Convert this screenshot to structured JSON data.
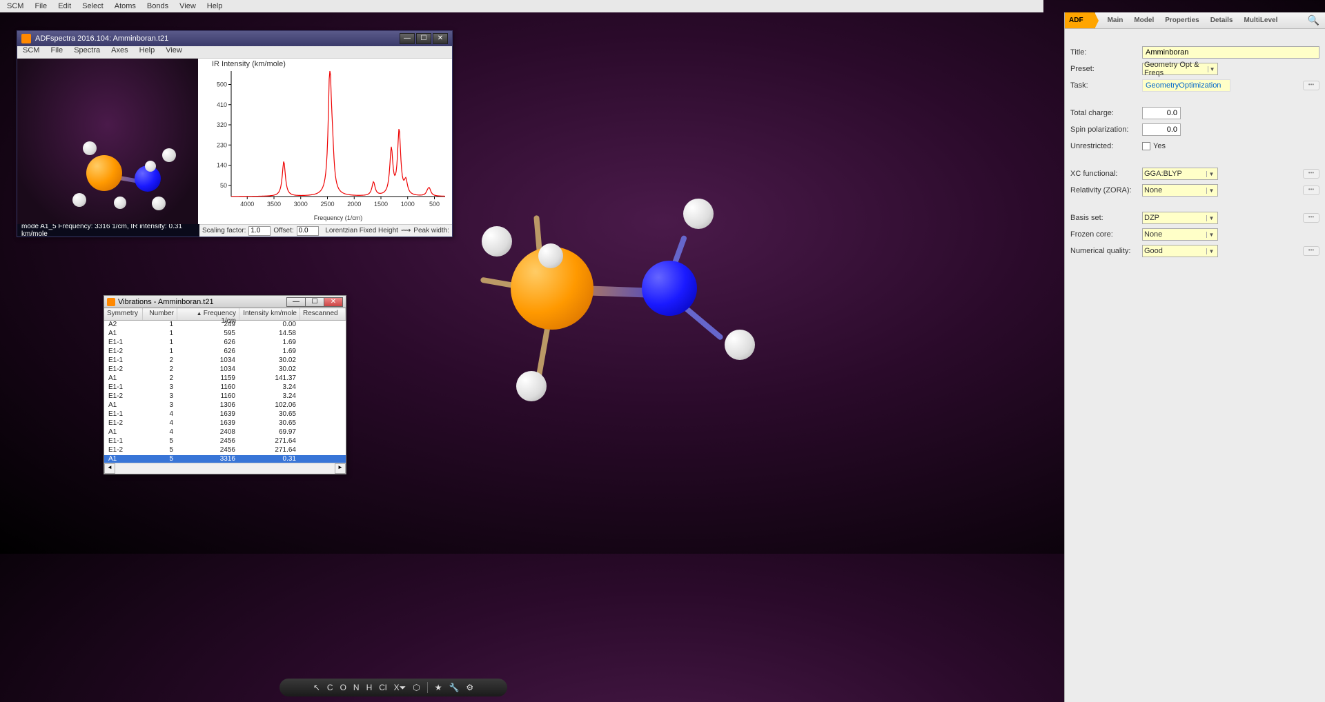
{
  "top_menu": [
    "SCM",
    "File",
    "Edit",
    "Select",
    "Atoms",
    "Bonds",
    "View",
    "Help"
  ],
  "right_panel": {
    "tabs": [
      "ADF",
      "Main",
      "Model",
      "Properties",
      "Details",
      "MultiLevel"
    ],
    "title_label": "Title:",
    "title_value": "Amminboran",
    "preset_label": "Preset:",
    "preset_value": "Geometry Opt & Freqs",
    "task_label": "Task:",
    "task_value": "GeometryOptimization",
    "charge_label": "Total charge:",
    "charge_value": "0.0",
    "spin_label": "Spin polarization:",
    "spin_value": "0.0",
    "unrestricted_label": "Unrestricted:",
    "unrestricted_yes": "Yes",
    "xc_label": "XC functional:",
    "xc_value": "GGA:BLYP",
    "rel_label": "Relativity (ZORA):",
    "rel_value": "None",
    "basis_label": "Basis set:",
    "basis_value": "DZP",
    "frozen_label": "Frozen core:",
    "frozen_value": "None",
    "numq_label": "Numerical quality:",
    "numq_value": "Good"
  },
  "spectra": {
    "title": "ADFspectra 2016.104: Amminboran.t21",
    "menu": [
      "SCM",
      "File",
      "Spectra",
      "Axes",
      "Help",
      "View"
    ],
    "status": "mode A1_5 Frequency: 3316 1/cm, IR intensity:   0.31 km/mole",
    "footer": {
      "scaling_label": "Scaling factor:",
      "scaling_value": "1.0",
      "offset_label": "Offset:",
      "offset_value": "0.0",
      "shape": "Lorentzian Fixed Height",
      "peak_label": "Peak width:"
    }
  },
  "vibrations": {
    "title": "Vibrations - Amminboran.t21",
    "headers": [
      "Symmetry",
      "Number",
      "Frequency 1/cm",
      "Intensity km/mole",
      "Rescanned"
    ],
    "rows": [
      {
        "sym": "A2",
        "num": "1",
        "freq": "249",
        "int": "0.00"
      },
      {
        "sym": "A1",
        "num": "1",
        "freq": "595",
        "int": "14.58"
      },
      {
        "sym": "E1-1",
        "num": "1",
        "freq": "626",
        "int": "1.69"
      },
      {
        "sym": "E1-2",
        "num": "1",
        "freq": "626",
        "int": "1.69"
      },
      {
        "sym": "E1-1",
        "num": "2",
        "freq": "1034",
        "int": "30.02"
      },
      {
        "sym": "E1-2",
        "num": "2",
        "freq": "1034",
        "int": "30.02"
      },
      {
        "sym": "A1",
        "num": "2",
        "freq": "1159",
        "int": "141.37"
      },
      {
        "sym": "E1-1",
        "num": "3",
        "freq": "1160",
        "int": "3.24"
      },
      {
        "sym": "E1-2",
        "num": "3",
        "freq": "1160",
        "int": "3.24"
      },
      {
        "sym": "A1",
        "num": "3",
        "freq": "1306",
        "int": "102.06"
      },
      {
        "sym": "E1-1",
        "num": "4",
        "freq": "1639",
        "int": "30.65"
      },
      {
        "sym": "E1-2",
        "num": "4",
        "freq": "1639",
        "int": "30.65"
      },
      {
        "sym": "A1",
        "num": "4",
        "freq": "2408",
        "int": "69.97"
      },
      {
        "sym": "E1-1",
        "num": "5",
        "freq": "2456",
        "int": "271.64"
      },
      {
        "sym": "E1-2",
        "num": "5",
        "freq": "2456",
        "int": "271.64"
      },
      {
        "sym": "A1",
        "num": "5",
        "freq": "3316",
        "int": "0.31",
        "sel": true
      }
    ]
  },
  "bottom_tools": [
    "↖",
    "C",
    "O",
    "N",
    "H",
    "Cl",
    "X⏷",
    "⬡",
    "",
    "★",
    "🔧",
    "⚙"
  ],
  "chart_data": {
    "type": "line",
    "title": "IR Intensity (km/mole)",
    "xlabel": "Frequency (1/cm)",
    "ylabel": "",
    "xlim": [
      4300,
      300
    ],
    "ylim": [
      0,
      560
    ],
    "xticks": [
      4000,
      3500,
      3000,
      2500,
      2000,
      1500,
      1000,
      500
    ],
    "yticks": [
      50,
      140,
      230,
      320,
      410,
      500
    ],
    "peaks": [
      {
        "x": 3316,
        "y": 156
      },
      {
        "x": 2456,
        "y": 543
      },
      {
        "x": 2408,
        "y": 140
      },
      {
        "x": 1639,
        "y": 61
      },
      {
        "x": 1306,
        "y": 204
      },
      {
        "x": 1160,
        "y": 289
      },
      {
        "x": 1034,
        "y": 60
      },
      {
        "x": 626,
        "y": 15
      },
      {
        "x": 595,
        "y": 29
      }
    ]
  }
}
